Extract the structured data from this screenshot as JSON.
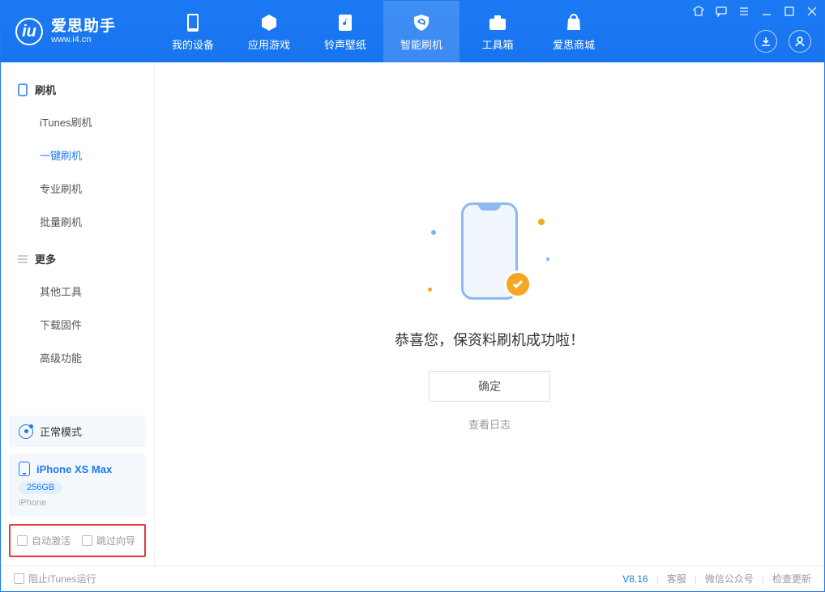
{
  "app": {
    "title": "爱思助手",
    "subtitle": "www.i4.cn"
  },
  "tabs": [
    {
      "label": "我的设备"
    },
    {
      "label": "应用游戏"
    },
    {
      "label": "铃声壁纸"
    },
    {
      "label": "智能刷机"
    },
    {
      "label": "工具箱"
    },
    {
      "label": "爱思商城"
    }
  ],
  "sidebar": {
    "section1": {
      "title": "刷机",
      "items": [
        "iTunes刷机",
        "一键刷机",
        "专业刷机",
        "批量刷机"
      ]
    },
    "section2": {
      "title": "更多",
      "items": [
        "其他工具",
        "下载固件",
        "高级功能"
      ]
    }
  },
  "mode": {
    "label": "正常模式"
  },
  "device": {
    "name": "iPhone XS Max",
    "capacity": "256GB",
    "type": "iPhone"
  },
  "options": {
    "auto_activate": "自动激活",
    "skip_guide": "跳过向导"
  },
  "result": {
    "message": "恭喜您，保资料刷机成功啦！",
    "ok": "确定",
    "view_log": "查看日志"
  },
  "footer": {
    "block_itunes": "阻止iTunes运行",
    "version": "V8.16",
    "service": "客服",
    "wechat": "微信公众号",
    "update": "检查更新"
  }
}
